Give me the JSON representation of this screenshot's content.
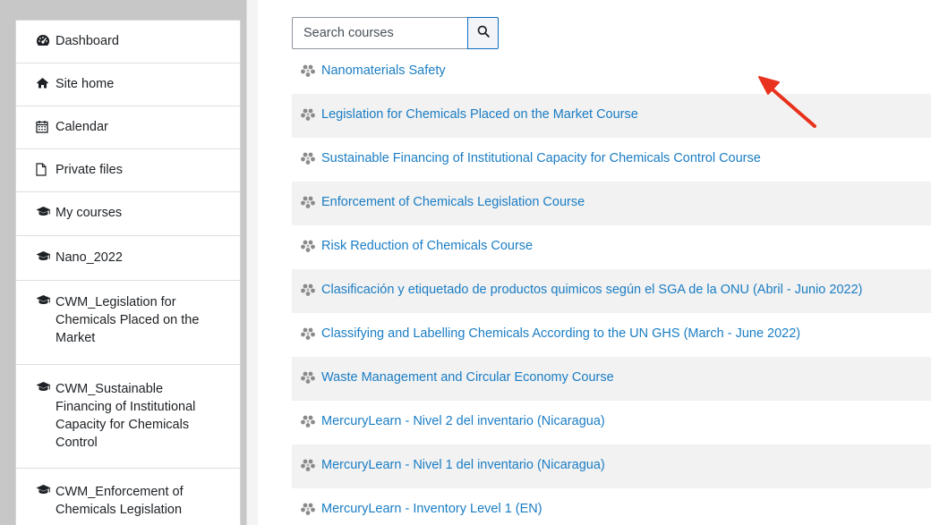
{
  "sidebar": {
    "items": [
      {
        "label": "Dashboard",
        "icon": "tachometer-icon"
      },
      {
        "label": "Site home",
        "icon": "home-icon"
      },
      {
        "label": "Calendar",
        "icon": "calendar-icon"
      },
      {
        "label": "Private files",
        "icon": "file-icon"
      },
      {
        "label": "My courses",
        "icon": "graduation-cap-icon"
      },
      {
        "label": "Nano_2022",
        "icon": "graduation-cap-icon"
      },
      {
        "label": "CWM_Legislation for Chemicals Placed on the Market",
        "line1": "CWM_Legislation for",
        "line2": "Chemicals Placed on the",
        "line3": "Market",
        "icon": "graduation-cap-icon"
      },
      {
        "label": "CWM_Sustainable Financing of Institutional Capacity for Chemicals Control",
        "line1": "CWM_Sustainable",
        "line2": "Financing of Institutional",
        "line3": "Capacity for Chemicals",
        "line4": "Control",
        "icon": "graduation-cap-icon"
      },
      {
        "label": "CWM_Enforcement of Chemicals Legislation",
        "line1": "CWM_Enforcement of",
        "line2": "Chemicals Legislation",
        "icon": "graduation-cap-icon"
      }
    ]
  },
  "search": {
    "placeholder": "Search courses",
    "icon": "search-icon"
  },
  "courses": [
    "Nanomaterials Safety",
    "Legislation for Chemicals Placed on the Market Course",
    "Sustainable Financing of Institutional Capacity for Chemicals Control Course",
    "Enforcement of Chemicals Legislation Course",
    "Risk Reduction of Chemicals Course",
    "Clasificación y etiquetado de productos quimicos según el SGA de la ONU (Abril - Junio 2022)",
    "Classifying and Labelling Chemicals According to the UN GHS (March - June 2022)",
    "Waste Management and Circular Economy Course",
    "MercuryLearn - Nivel 2 del inventario (Nicaragua)",
    "MercuryLearn - Nivel 1 del inventario (Nicaragua)",
    "MercuryLearn - Inventory Level 1 (EN)"
  ],
  "colors": {
    "link": "#1a7dc4",
    "annotation_arrow": "#e8321e",
    "stripe": "#f2f2f2"
  }
}
